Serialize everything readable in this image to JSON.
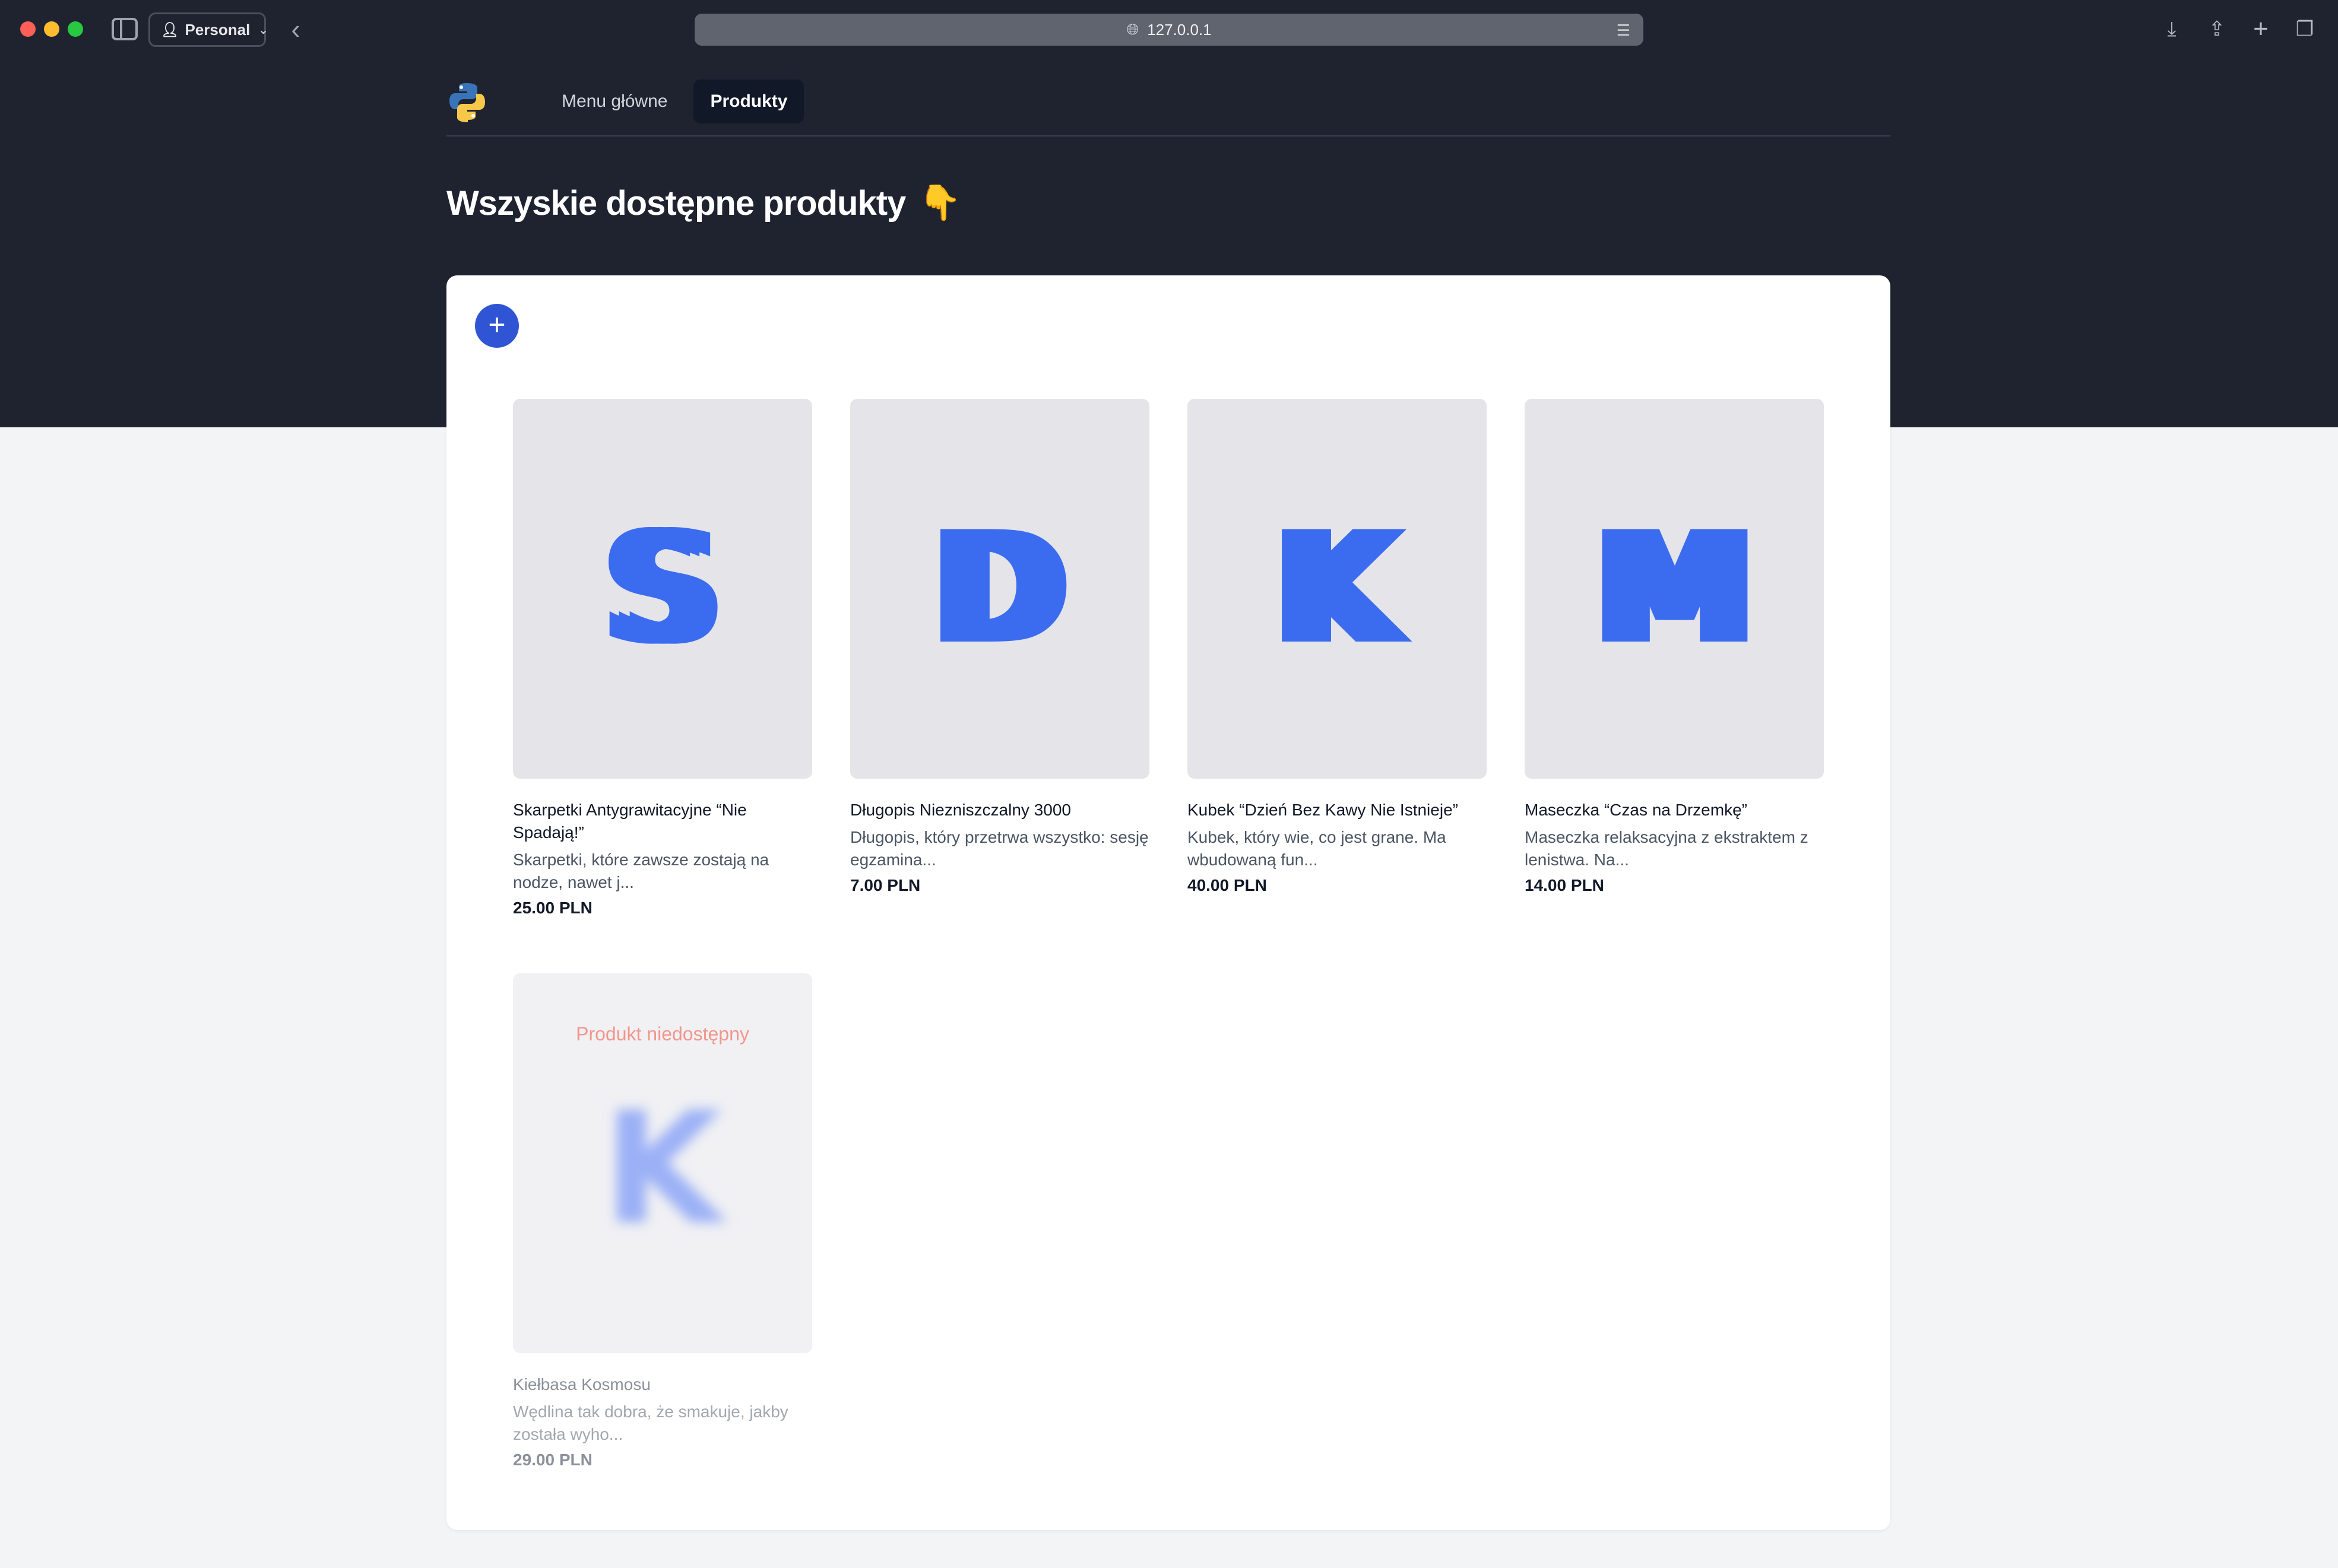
{
  "browser": {
    "profile_label": "Personal",
    "url": "127.0.0.1"
  },
  "nav": {
    "items": [
      {
        "label": "Menu główne"
      },
      {
        "label": "Produkty"
      }
    ]
  },
  "page": {
    "title": "Wszyskie dostępne produkty",
    "title_emoji": "👇"
  },
  "add_button": {
    "label": "+"
  },
  "products": [
    {
      "letter": "S",
      "name": "Skarpetki Antygrawitacyjne “Nie Spadają!”",
      "description": "Skarpetki, które zawsze zostają na nodze, nawet j...",
      "price": "25.00 PLN"
    },
    {
      "letter": "D",
      "name": "Długopis Niezniszczalny 3000",
      "description": "Długopis, który przetrwa wszystko: sesję egzamina...",
      "price": "7.00 PLN"
    },
    {
      "letter": "K",
      "name": "Kubek “Dzień Bez Kawy Nie Istnieje”",
      "description": "Kubek, który wie, co jest grane. Ma wbudowaną fun...",
      "price": "40.00 PLN"
    },
    {
      "letter": "M",
      "name": "Maseczka “Czas na Drzemkę”",
      "description": "Maseczka relaksacyjna z ekstraktem z lenistwa. Na...",
      "price": "14.00 PLN"
    },
    {
      "letter": "K",
      "status": "Produkt niedostępny",
      "name": "Kiełbasa Kosmosu",
      "description": "Wędlina tak dobra, że smakuje, jakby została wyho...",
      "price": "29.00 PLN"
    }
  ],
  "colors": {
    "header_bg": "#1f2330",
    "accent": "#2f55d4",
    "placeholder_letter": "#3b6cf0",
    "unavailable": "#f2968c"
  }
}
